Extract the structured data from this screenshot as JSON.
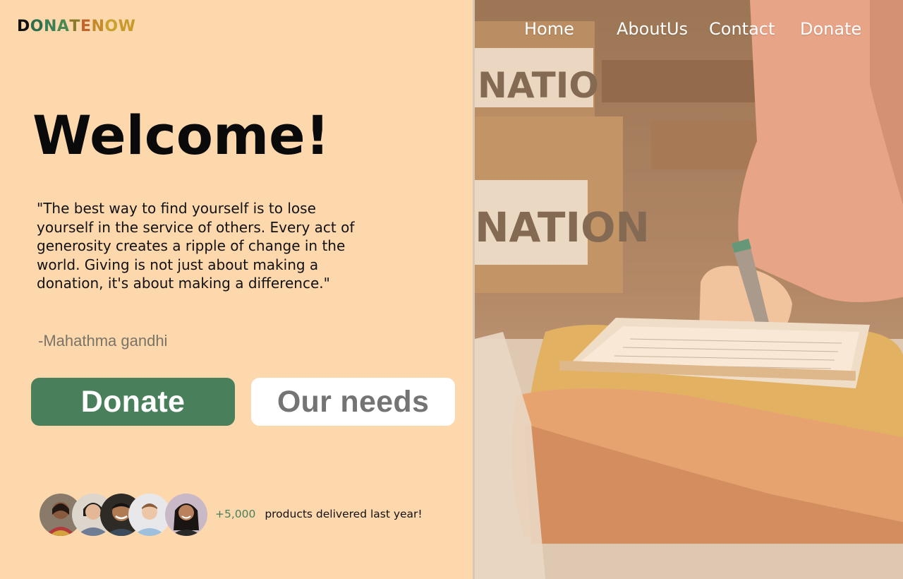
{
  "brand": {
    "logo_letters": [
      {
        "char": "D",
        "color": "#111111"
      },
      {
        "char": "O",
        "color": "#2f6e4a"
      },
      {
        "char": "N",
        "color": "#3b7f56"
      },
      {
        "char": "A",
        "color": "#4a8a52"
      },
      {
        "char": "T",
        "color": "#8c7a2a"
      },
      {
        "char": "E",
        "color": "#c0662a"
      },
      {
        "char": "N",
        "color": "#c48a2a"
      },
      {
        "char": "O",
        "color": "#c9a12e"
      },
      {
        "char": "W",
        "color": "#c79a2a"
      }
    ]
  },
  "nav": {
    "home": "Home",
    "about": "AboutUs",
    "contact": "Contact",
    "donate": "Donate"
  },
  "hero": {
    "title": "Welcome!",
    "quote": "\"The best way to find yourself is to lose yourself in the service of others. Every act of generosity creates a ripple of change in the world. Giving is not just about making a donation, it's about making a difference.\"",
    "author": "-Mahathma gandhi"
  },
  "buttons": {
    "donate": "Donate",
    "needs": "Our needs"
  },
  "stats": {
    "count": "+5,000",
    "text": "products delivered last year!"
  },
  "colors": {
    "background": "#fdd8ad",
    "accent_green": "#4a7f5c",
    "button_secondary": "#ffffff",
    "muted_text": "#747474"
  },
  "image": {
    "box_label_top": "NATION",
    "box_label_bottom": "NATION"
  }
}
